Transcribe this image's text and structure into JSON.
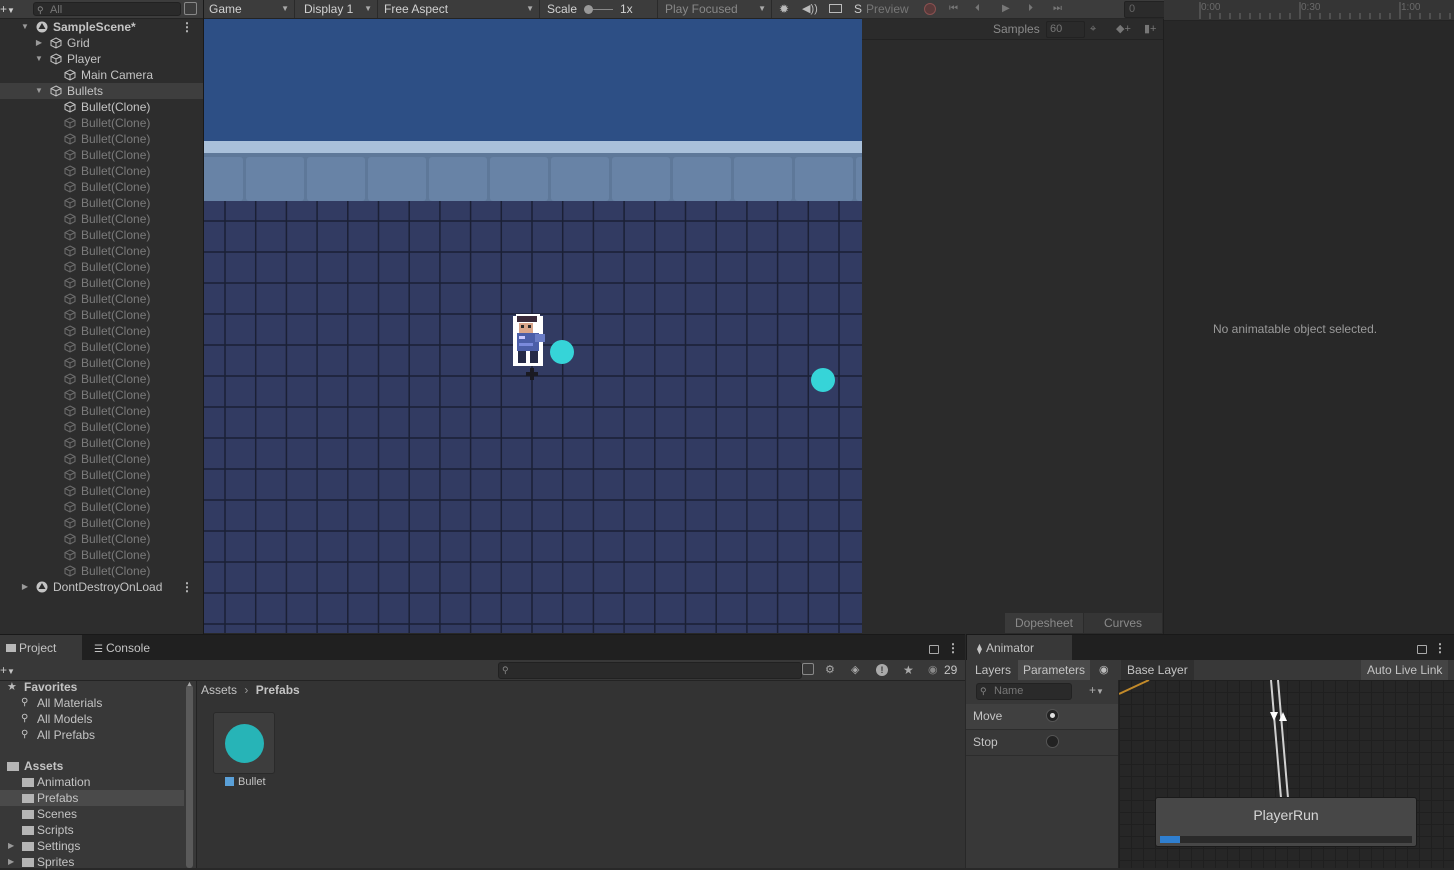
{
  "hierarchy": {
    "search_placeholder": "All",
    "rows": [
      {
        "label": "SampleScene*",
        "indent": 0,
        "expanded": true,
        "icon": "unity-scene-icon",
        "bold": true,
        "dim": false,
        "menu": true
      },
      {
        "label": "Grid",
        "indent": 1,
        "expanded": false,
        "icon": "cube-icon",
        "dim": false
      },
      {
        "label": "Player",
        "indent": 1,
        "expanded": true,
        "icon": "cube-icon",
        "dim": false
      },
      {
        "label": "Main Camera",
        "indent": 2,
        "icon": "cube-icon",
        "dim": false
      },
      {
        "label": "Bullets",
        "indent": 1,
        "expanded": true,
        "icon": "cube-icon",
        "dim": false,
        "selected": true
      },
      {
        "label": "Bullet(Clone)",
        "indent": 2,
        "icon": "cube-icon",
        "dim": false
      },
      {
        "label": "Bullet(Clone)",
        "indent": 2,
        "icon": "cube-icon",
        "dim": true
      },
      {
        "label": "Bullet(Clone)",
        "indent": 2,
        "icon": "cube-icon",
        "dim": true
      },
      {
        "label": "Bullet(Clone)",
        "indent": 2,
        "icon": "cube-icon",
        "dim": true
      },
      {
        "label": "Bullet(Clone)",
        "indent": 2,
        "icon": "cube-icon",
        "dim": true
      },
      {
        "label": "Bullet(Clone)",
        "indent": 2,
        "icon": "cube-icon",
        "dim": true
      },
      {
        "label": "Bullet(Clone)",
        "indent": 2,
        "icon": "cube-icon",
        "dim": true
      },
      {
        "label": "Bullet(Clone)",
        "indent": 2,
        "icon": "cube-icon",
        "dim": true
      },
      {
        "label": "Bullet(Clone)",
        "indent": 2,
        "icon": "cube-icon",
        "dim": true
      },
      {
        "label": "Bullet(Clone)",
        "indent": 2,
        "icon": "cube-icon",
        "dim": true
      },
      {
        "label": "Bullet(Clone)",
        "indent": 2,
        "icon": "cube-icon",
        "dim": true
      },
      {
        "label": "Bullet(Clone)",
        "indent": 2,
        "icon": "cube-icon",
        "dim": true
      },
      {
        "label": "Bullet(Clone)",
        "indent": 2,
        "icon": "cube-icon",
        "dim": true
      },
      {
        "label": "Bullet(Clone)",
        "indent": 2,
        "icon": "cube-icon",
        "dim": true
      },
      {
        "label": "Bullet(Clone)",
        "indent": 2,
        "icon": "cube-icon",
        "dim": true
      },
      {
        "label": "Bullet(Clone)",
        "indent": 2,
        "icon": "cube-icon",
        "dim": true
      },
      {
        "label": "Bullet(Clone)",
        "indent": 2,
        "icon": "cube-icon",
        "dim": true
      },
      {
        "label": "Bullet(Clone)",
        "indent": 2,
        "icon": "cube-icon",
        "dim": true
      },
      {
        "label": "Bullet(Clone)",
        "indent": 2,
        "icon": "cube-icon",
        "dim": true
      },
      {
        "label": "Bullet(Clone)",
        "indent": 2,
        "icon": "cube-icon",
        "dim": true
      },
      {
        "label": "Bullet(Clone)",
        "indent": 2,
        "icon": "cube-icon",
        "dim": true
      },
      {
        "label": "Bullet(Clone)",
        "indent": 2,
        "icon": "cube-icon",
        "dim": true
      },
      {
        "label": "Bullet(Clone)",
        "indent": 2,
        "icon": "cube-icon",
        "dim": true
      },
      {
        "label": "Bullet(Clone)",
        "indent": 2,
        "icon": "cube-icon",
        "dim": true
      },
      {
        "label": "Bullet(Clone)",
        "indent": 2,
        "icon": "cube-icon",
        "dim": true
      },
      {
        "label": "Bullet(Clone)",
        "indent": 2,
        "icon": "cube-icon",
        "dim": true
      },
      {
        "label": "Bullet(Clone)",
        "indent": 2,
        "icon": "cube-icon",
        "dim": true
      },
      {
        "label": "Bullet(Clone)",
        "indent": 2,
        "icon": "cube-icon",
        "dim": true
      },
      {
        "label": "Bullet(Clone)",
        "indent": 2,
        "icon": "cube-icon",
        "dim": true
      },
      {
        "label": "Bullet(Clone)",
        "indent": 2,
        "icon": "cube-icon",
        "dim": true
      },
      {
        "label": "DontDestroyOnLoad",
        "indent": 0,
        "expanded": false,
        "icon": "unity-scene-icon",
        "dim": false,
        "menu": true
      }
    ]
  },
  "game_toolbar": {
    "view": "Game",
    "display": "Display 1",
    "aspect": "Free Aspect",
    "scale_label": "Scale",
    "scale_value": "1x",
    "play_mode": "Play Focused",
    "cut_label": "S"
  },
  "animation": {
    "preview_label": "Preview",
    "frame_value": "0",
    "samples_label": "Samples",
    "samples_value": "60",
    "timeline_ticks": [
      "0:00",
      "0:30",
      "1:00"
    ],
    "empty_message": "No animatable object selected.",
    "tab_dopesheet": "Dopesheet",
    "tab_curves": "Curves"
  },
  "project": {
    "tab_project": "Project",
    "tab_console": "Console",
    "hidden_count": "29",
    "breadcrumb": [
      "Assets",
      "Prefabs"
    ],
    "favorites_label": "Favorites",
    "favorites": [
      "All Materials",
      "All Models",
      "All Prefabs"
    ],
    "assets_label": "Assets",
    "folders": [
      {
        "label": "Animation",
        "selected": false,
        "expandable": false
      },
      {
        "label": "Prefabs",
        "selected": true,
        "expandable": false
      },
      {
        "label": "Scenes",
        "selected": false,
        "expandable": false
      },
      {
        "label": "Scripts",
        "selected": false,
        "expandable": false
      },
      {
        "label": "Settings",
        "selected": false,
        "expandable": true
      },
      {
        "label": "Sprites",
        "selected": false,
        "expandable": true
      }
    ],
    "asset_name": "Bullet",
    "bullet_color": "#27b4b7"
  },
  "animator": {
    "tab_label": "Animator",
    "layers_label": "Layers",
    "parameters_label": "Parameters",
    "base_layer": "Base Layer",
    "auto_live_link": "Auto Live Link",
    "name_placeholder": "Name",
    "params": [
      {
        "name": "Move",
        "value": true
      },
      {
        "name": "Stop",
        "value": false
      }
    ],
    "state_name": "PlayerRun",
    "state_progress": 0.08
  },
  "scene": {
    "sky_color": "#2d4f85",
    "floor_color": "#323b62",
    "bullet_color": "#36d4d8"
  }
}
